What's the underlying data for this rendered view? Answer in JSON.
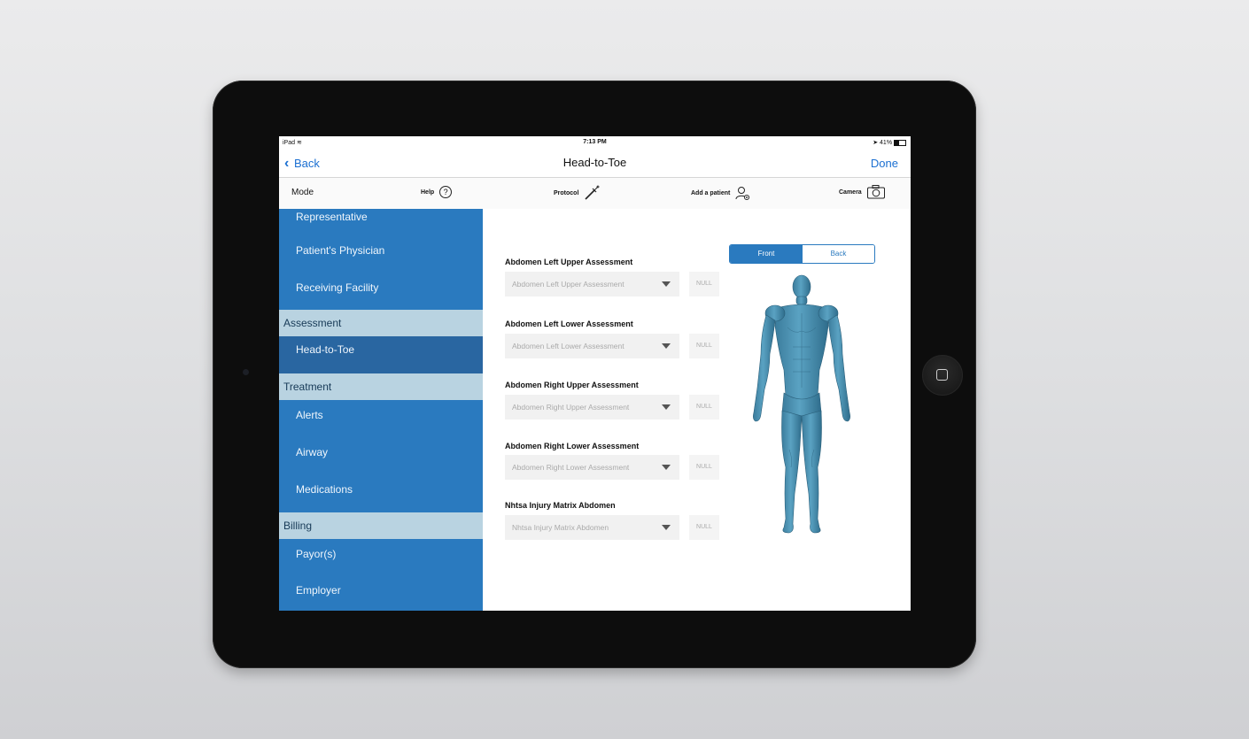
{
  "status_bar": {
    "device": "iPad",
    "wifi_icon": "wifi-icon",
    "time": "7:13 PM",
    "battery": "41%",
    "battery_level": 0.41
  },
  "nav": {
    "back_label": "Back",
    "title": "Head-to-Toe",
    "done_label": "Done"
  },
  "toolbar": {
    "mode_label": "Mode",
    "help_label": "Help",
    "help_glyph": "?",
    "protocol_label": "Protocol",
    "add_patient_label": "Add a patient",
    "camera_label": "Camera"
  },
  "sidebar": {
    "items_top": [
      "Representative",
      "Patient's Physician",
      "Receiving Facility"
    ],
    "section_assessment": "Assessment",
    "assessment_items": [
      "Head-to-Toe"
    ],
    "section_treatment": "Treatment",
    "treatment_items": [
      "Alerts",
      "Airway",
      "Medications"
    ],
    "section_billing": "Billing",
    "billing_items": [
      "Payor(s)",
      "Employer"
    ],
    "selected": "Head-to-Toe"
  },
  "form": {
    "fields": [
      {
        "label": "Abdomen Left Upper Assessment",
        "placeholder": "Abdomen Left Upper Assessment",
        "null_label": "NULL"
      },
      {
        "label": "Abdomen Left Lower Assessment",
        "placeholder": "Abdomen Left Lower Assessment",
        "null_label": "NULL"
      },
      {
        "label": "Abdomen Right Upper Assessment",
        "placeholder": "Abdomen Right Upper Assessment",
        "null_label": "NULL"
      },
      {
        "label": "Abdomen Right Lower Assessment",
        "placeholder": "Abdomen Right Lower Assessment",
        "null_label": "NULL"
      },
      {
        "label": "Nhtsa Injury Matrix Abdomen",
        "placeholder": "Nhtsa Injury Matrix Abdomen",
        "null_label": "NULL"
      }
    ]
  },
  "body_view": {
    "front_label": "Front",
    "back_label": "Back",
    "selected": "Front",
    "figure_icon": "human-body-front-figure"
  },
  "colors": {
    "sidebar_bg": "#2a7abf",
    "sidebar_selected": "#2966a1",
    "section_bg": "#b9d3e1",
    "accent_blue": "#1b6fd1",
    "figure_color": "#4f93b3"
  }
}
